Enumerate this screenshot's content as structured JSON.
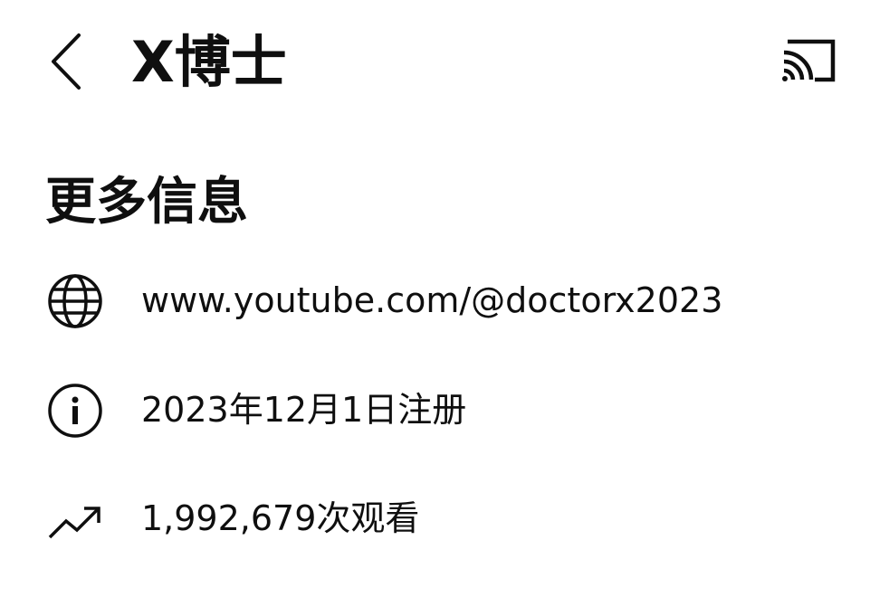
{
  "header": {
    "title": "X博士",
    "back_icon": "chevron-left-icon",
    "cast_icon": "cast-icon"
  },
  "section": {
    "heading": "更多信息"
  },
  "info": {
    "link": {
      "icon": "globe-icon",
      "text": "www.youtube.com/@doctorx2023"
    },
    "joined": {
      "icon": "info-icon",
      "text": "2023年12月1日注册"
    },
    "views": {
      "icon": "trending-up-icon",
      "text": "1,992,679次观看"
    }
  }
}
